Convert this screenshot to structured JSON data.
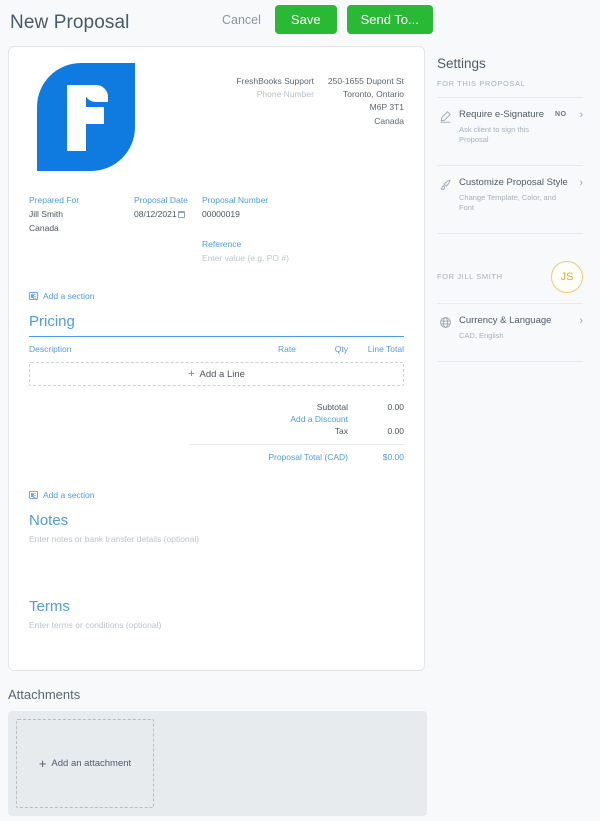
{
  "topbar": {
    "title": "New Proposal",
    "cancel_label": "Cancel",
    "save_label": "Save",
    "send_label": "Send To..."
  },
  "document": {
    "business": {
      "name": "FreshBooks Support",
      "phone_placeholder": "Phone Number",
      "address_line1": "250-1655 Dupont St",
      "address_line2": "Toronto, Ontario",
      "address_line3": "M6P 3T1",
      "address_line4": "Canada"
    },
    "meta": {
      "prepared_for_label": "Prepared For",
      "prepared_for_name": "Jill Smith",
      "prepared_for_country": "Canada",
      "date_label": "Proposal Date",
      "date_value": "08/12/2021",
      "number_label": "Proposal Number",
      "number_value": "00000019",
      "reference_label": "Reference",
      "reference_placeholder": "Enter value (e.g. PO #)"
    },
    "add_section_label": "Add a section",
    "pricing": {
      "title": "Pricing",
      "columns": [
        "Description",
        "Rate",
        "Qty",
        "Line Total"
      ],
      "rows": [],
      "add_line_label": "Add a Line"
    },
    "totals": {
      "subtotal_label": "Subtotal",
      "subtotal_value": "0.00",
      "discount_label": "Add a Discount",
      "tax_label": "Tax",
      "tax_value": "0.00",
      "total_label": "Proposal Total (CAD)",
      "total_value": "$0.00"
    },
    "notes": {
      "title": "Notes",
      "placeholder": "Enter notes or bank transfer details (optional)"
    },
    "terms": {
      "title": "Terms",
      "placeholder": "Enter terms or conditions (optional)"
    }
  },
  "settings": {
    "title": "Settings",
    "caption_proposal": "FOR THIS PROPOSAL",
    "caption_client": "FOR JILL SMITH",
    "avatar_initials": "JS",
    "items": [
      {
        "label": "Require e-Signature",
        "sub": "Ask client to sign this Proposal",
        "badge": "NO"
      },
      {
        "label": "Customize Proposal Style",
        "sub": "Change Template, Color, and Font",
        "badge": ""
      }
    ],
    "client_items": [
      {
        "label": "Currency & Language",
        "sub": "CAD, English",
        "badge": ""
      }
    ]
  },
  "attachments": {
    "title": "Attachments",
    "add_label": "Add an attachment"
  },
  "colors": {
    "accent_blue": "#4f9bea",
    "logo_blue": "#0f7ae0",
    "action_green": "#2ab934",
    "avatar_gold": "#e0a93e"
  }
}
